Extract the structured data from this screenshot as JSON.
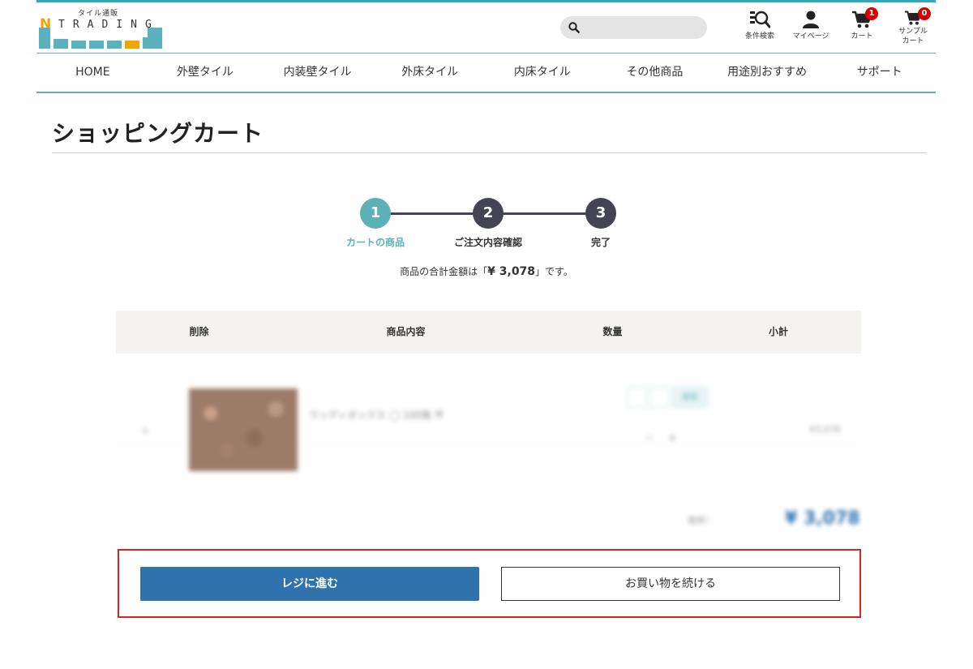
{
  "header": {
    "logo": {
      "sub": "タイル通販",
      "initial": "N",
      "word": "TRADING"
    },
    "search": {
      "placeholder": ""
    },
    "icons": [
      {
        "name": "search-filter-icon",
        "label": "条件検索"
      },
      {
        "name": "user-icon",
        "label": "マイページ"
      },
      {
        "name": "cart-icon",
        "label": "カート",
        "badge": "1"
      },
      {
        "name": "sample-cart-icon",
        "label": "サンプル\nカート",
        "badge": "0"
      }
    ]
  },
  "nav": {
    "items": [
      "HOME",
      "外壁タイル",
      "内装壁タイル",
      "外床タイル",
      "内床タイル",
      "その他商品",
      "用途別おすすめ",
      "サポート"
    ]
  },
  "page": {
    "title": "ショッピングカート"
  },
  "steps": [
    {
      "number": "1",
      "label": "カートの商品",
      "active": true
    },
    {
      "number": "2",
      "label": "ご注文内容確認",
      "active": false
    },
    {
      "number": "3",
      "label": "完了",
      "active": false
    }
  ],
  "summary": {
    "prefix": "商品の合計金額は「",
    "amount": "¥ 3,078",
    "suffix": "」です。"
  },
  "table": {
    "headers": [
      "削除",
      "商品内容",
      "数量",
      "小計"
    ],
    "rows": [
      {
        "delete_label": "×",
        "product_name": "ウッディボックス ◯ 100角 平",
        "update_label": "更新",
        "minus_label": "−",
        "plus_label": "+",
        "subtotal": "¥3,078"
      }
    ],
    "total_label": "合計：",
    "total_value": "¥ 3,078"
  },
  "actions": {
    "checkout_label": "レジに進む",
    "continue_label": "お買い物を続ける"
  },
  "colors": {
    "accent": "#5cb1b6",
    "primary_button": "#2f72ae",
    "frame": "#d9231f",
    "badge": "#d60000",
    "step_inactive": "#444354"
  }
}
